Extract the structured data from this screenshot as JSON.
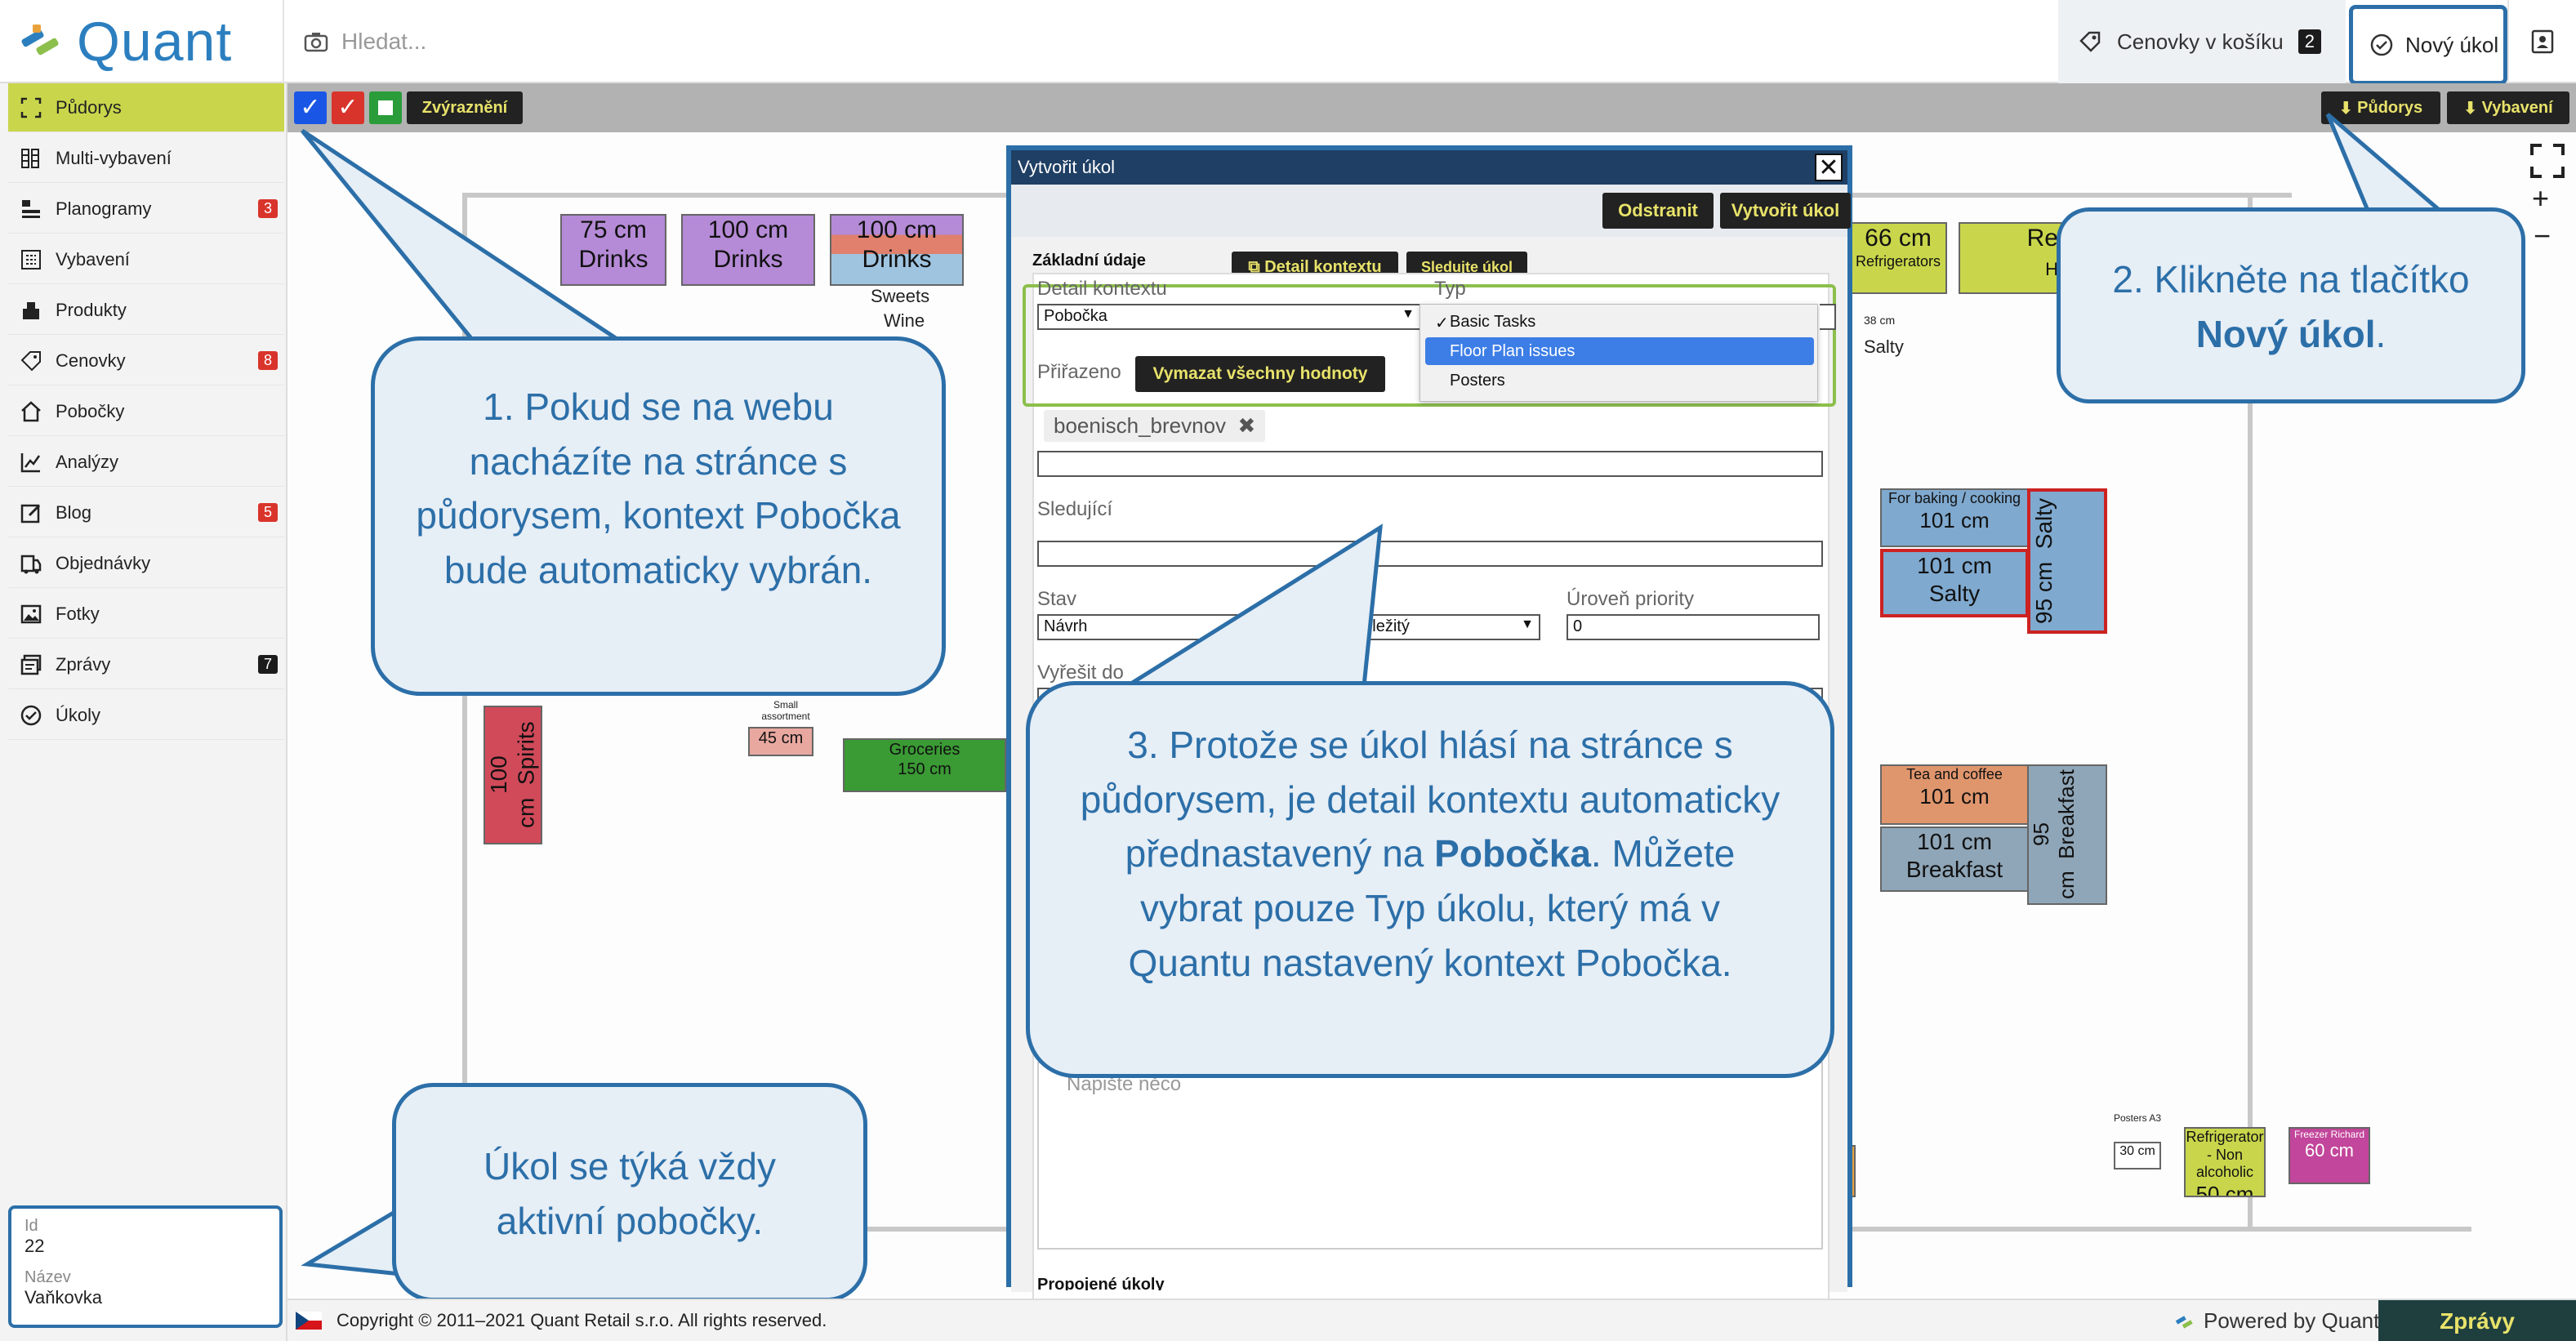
{
  "app": {
    "logo_text": "Quant"
  },
  "header": {
    "search_placeholder": "Hledat...",
    "cart_label": "Cenovky v košíku",
    "cart_count": "2",
    "new_task_label": "Nový úkol"
  },
  "sidebar": {
    "items": [
      {
        "label": "Půdorys",
        "badge": "",
        "icon": "floorplan-icon"
      },
      {
        "label": "Multi-vybavení",
        "badge": "",
        "icon": "multi-equipment-icon"
      },
      {
        "label": "Planogramy",
        "badge": "3",
        "icon": "planogram-icon"
      },
      {
        "label": "Vybavení",
        "badge": "",
        "icon": "equipment-icon"
      },
      {
        "label": "Produkty",
        "badge": "",
        "icon": "products-icon"
      },
      {
        "label": "Cenovky",
        "badge": "8",
        "icon": "price-tag-icon"
      },
      {
        "label": "Pobočky",
        "badge": "",
        "icon": "branch-icon"
      },
      {
        "label": "Analýzy",
        "badge": "",
        "icon": "analysis-icon"
      },
      {
        "label": "Blog",
        "badge": "5",
        "icon": "blog-icon"
      },
      {
        "label": "Objednávky",
        "badge": "",
        "icon": "orders-icon"
      },
      {
        "label": "Fotky",
        "badge": "",
        "icon": "photos-icon"
      },
      {
        "label": "Zprávy",
        "badge": "7",
        "icon": "messages-icon"
      },
      {
        "label": "Úkoly",
        "badge": "",
        "icon": "tasks-icon"
      }
    ],
    "branch": {
      "id_label": "Id",
      "id_value": "22",
      "name_label": "Název",
      "name_value": "Vaňkovka"
    }
  },
  "toolbar": {
    "highlight_label": "Zvýraznění",
    "floorplan_dl": "Půdorys",
    "equipment_dl": "Vybavení",
    "zoom_in": "+",
    "zoom_out": "−"
  },
  "floorplan": {
    "fixtures": [
      {
        "size": "75 cm",
        "name": "Drinks"
      },
      {
        "size": "100 cm",
        "name": "Drinks"
      },
      {
        "size": "100 cm",
        "name": "Drinks"
      },
      {
        "size": "66 cm",
        "name": "Refrigerators"
      },
      {
        "size": "101 cm",
        "name": "For baking / cooking"
      },
      {
        "size": "101 cm",
        "name": "Salty"
      },
      {
        "size": "95 cm",
        "name": "Salty"
      },
      {
        "size": "101 cm",
        "name": "Tea and coffee"
      },
      {
        "size": "101 cm",
        "name": "Breakfast"
      },
      {
        "size": "95 cm",
        "name": "Breakfast"
      },
      {
        "size": "100 cm",
        "name": "Spirits"
      },
      {
        "size": "150 cm",
        "name": "Groceries"
      },
      {
        "size": "45 cm",
        "name": "Small assortment"
      },
      {
        "size": "50 cm",
        "name": "Refrigerator - Non alcoholic"
      },
      {
        "size": "60 cm",
        "name": "Freezer Richard"
      },
      {
        "size": "30 cm",
        "name": "Posters A3"
      }
    ],
    "labels": {
      "sweets": "Sweets",
      "wine": "Wine",
      "salty_small": "Salty",
      "size_38": "38 cm",
      "re": "Re",
      "h": "H"
    }
  },
  "modal": {
    "title": "Vytvořit úkol",
    "close": "✕",
    "delete_btn": "Odstranit",
    "create_btn": "Vytvořit úkol",
    "section_title": "Základní údaje",
    "tab_context": "Detail kontextu",
    "tab_follow": "Sledujte úkol",
    "context_label": "Detail kontextu",
    "context_value": "Pobočka",
    "type_label": "Typ",
    "type_options": [
      "Basic Tasks",
      "Floor Plan issues",
      "Posters"
    ],
    "assigned_label": "Přiřazeno",
    "clear_btn": "Vymazat všechny hodnoty",
    "assigned_tag": "boenisch_brevnov",
    "followers_label": "Sledující",
    "state_label": "Stav",
    "state_value": "Návrh",
    "importance_value": "důležitý",
    "priority_label": "Úroveň priority",
    "priority_value": "0",
    "deadline_label": "Vyřešit do",
    "note_placeholder": "Napište něco",
    "linked_label": "Propojené úkoly"
  },
  "callouts": {
    "c1": "1. Pokud se na webu nacházíte na stránce s půdorysem, kontext Pobočka bude automaticky vybrán.",
    "c2_a": "2. Klikněte na tlačítko ",
    "c2_b": "Nový úkol",
    "c2_c": ".",
    "c3_a": "3. Protože se úkol hlásí na stránce s půdorysem, je detail kontextu automaticky přednastavený na ",
    "c3_b": "Pobočka",
    "c3_c": ". Můžete vybrat pouze Typ úkolu, který má v Quantu nastavený kontext Pobočka.",
    "c4": "Úkol se týká vždy aktivní pobočky."
  },
  "footer": {
    "copyright": "Copyright © 2011–2021 Quant Retail s.r.o. All rights reserved.",
    "powered": "Powered by Quant",
    "messages": "Zprávy"
  },
  "colors": {
    "accent": "#2c6fa8",
    "active": "#c9d64b",
    "badge_red": "#d9342b",
    "dark_btn": "#222222",
    "btn_text": "#e8e26a"
  }
}
